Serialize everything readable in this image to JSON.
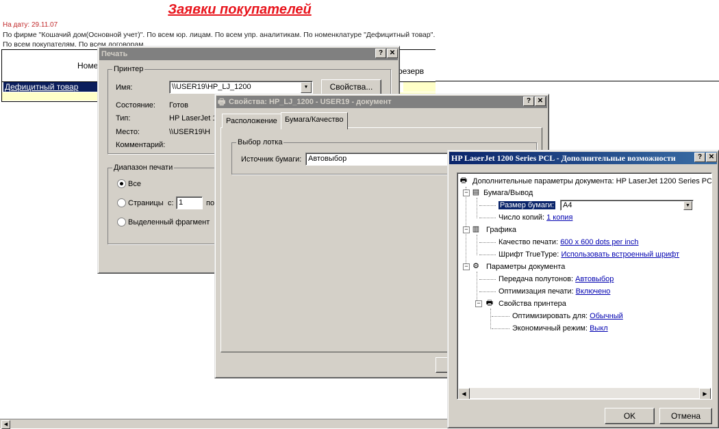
{
  "report": {
    "title": "Заявки покупателей",
    "date": "На дату: 29.11.07",
    "description": "По фирме \"Кошачий дом(Основной учет)\". По всем юр. лицам. По всем упр. аналитикам. По номенклатуре \"Дефицитный товар\". По всем покупателям. По всем договорам.",
    "col_name": "Номе",
    "col_reserve": "резерв",
    "row_label": "Дефицитный товар"
  },
  "print_dialog": {
    "title": "Печать",
    "printer_group": "Принтер",
    "name_label": "Имя:",
    "name_value": "\\\\USER19\\HP_LJ_1200",
    "properties_button": "Свойства...",
    "status_label": "Состояние:",
    "status_value": "Готов",
    "type_label": "Тип:",
    "type_value": "HP LaserJet 1",
    "where_label": "Место:",
    "where_value": "\\\\USER19\\H",
    "comment_label": "Комментарий:",
    "range_group": "Диапазон печати",
    "range_all": "Все",
    "range_pages": "Страницы",
    "pages_from_label": "с:",
    "pages_from_value": "1",
    "pages_to_label": "по",
    "range_selection": "Выделенный фрагмент"
  },
  "properties_dialog": {
    "title": "Свойства: HP_LJ_1200 - USER19 - документ",
    "tabs": [
      "Расположение",
      "Бумага/Качество"
    ],
    "tray_group": "Выбор лотка",
    "paper_source_label": "Источник бумаги:",
    "paper_source_value": "Автовыбор"
  },
  "advanced_dialog": {
    "title": "HP LaserJet 1200 Series PCL - Дополнительные возможности",
    "root": "Дополнительные параметры документа: HP LaserJet 1200 Series PC",
    "paper_output": "Бумага/Вывод",
    "paper_size_label": "Размер бумаги:",
    "paper_size_value": "A4",
    "copies_label": "Число копий:",
    "copies_value": "1 копия",
    "graphics": "Графика",
    "quality_label": "Качество печати:",
    "quality_value": "600 x 600 dots per inch",
    "truetype_label": "Шрифт TrueType:",
    "truetype_value": "Использовать встроенный шрифт",
    "doc_options": "Параметры документа",
    "halftone_label": "Передача полутонов:",
    "halftone_value": "Автовыбор",
    "optimization_label": "Оптимизация печати:",
    "optimization_value": "Включено",
    "printer_features": "Свойства принтера",
    "optimize_for_label": "Оптимизировать для:",
    "optimize_for_value": "Обычный",
    "economode_label": "Экономичный режим:",
    "economode_value": "Выкл",
    "ok_button": "OK",
    "cancel_button": "Отмена"
  },
  "titlebar_buttons": {
    "help": "?",
    "close": "✕"
  },
  "icons": {
    "expander": "−",
    "dropdown": "▼",
    "left": "◀",
    "right": "▶",
    "printer": "🖶"
  }
}
